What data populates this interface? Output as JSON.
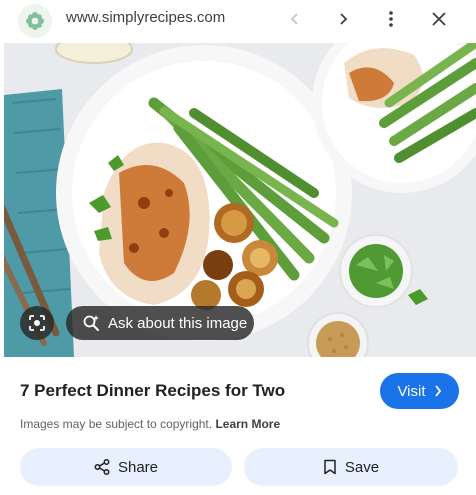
{
  "header": {
    "site_url": "www.simplyrecipes.com",
    "favicon_color": "#7fbf9a",
    "icons": [
      "chevron-left-icon",
      "chevron-right-icon",
      "more-vert-icon",
      "close-icon"
    ]
  },
  "image_overlay": {
    "ask_label": "Ask about this image",
    "lens_icon": "lens-icon"
  },
  "result": {
    "title": "7 Perfect Dinner Recipes for Two",
    "visit_label": "Visit",
    "copyright_text": "Images may be subject to copyright.",
    "learn_more_label": "Learn More"
  },
  "actions": {
    "share_label": "Share",
    "save_label": "Save"
  },
  "colors": {
    "accent": "#1a73e8",
    "pill_bg": "#e8f0fe"
  }
}
